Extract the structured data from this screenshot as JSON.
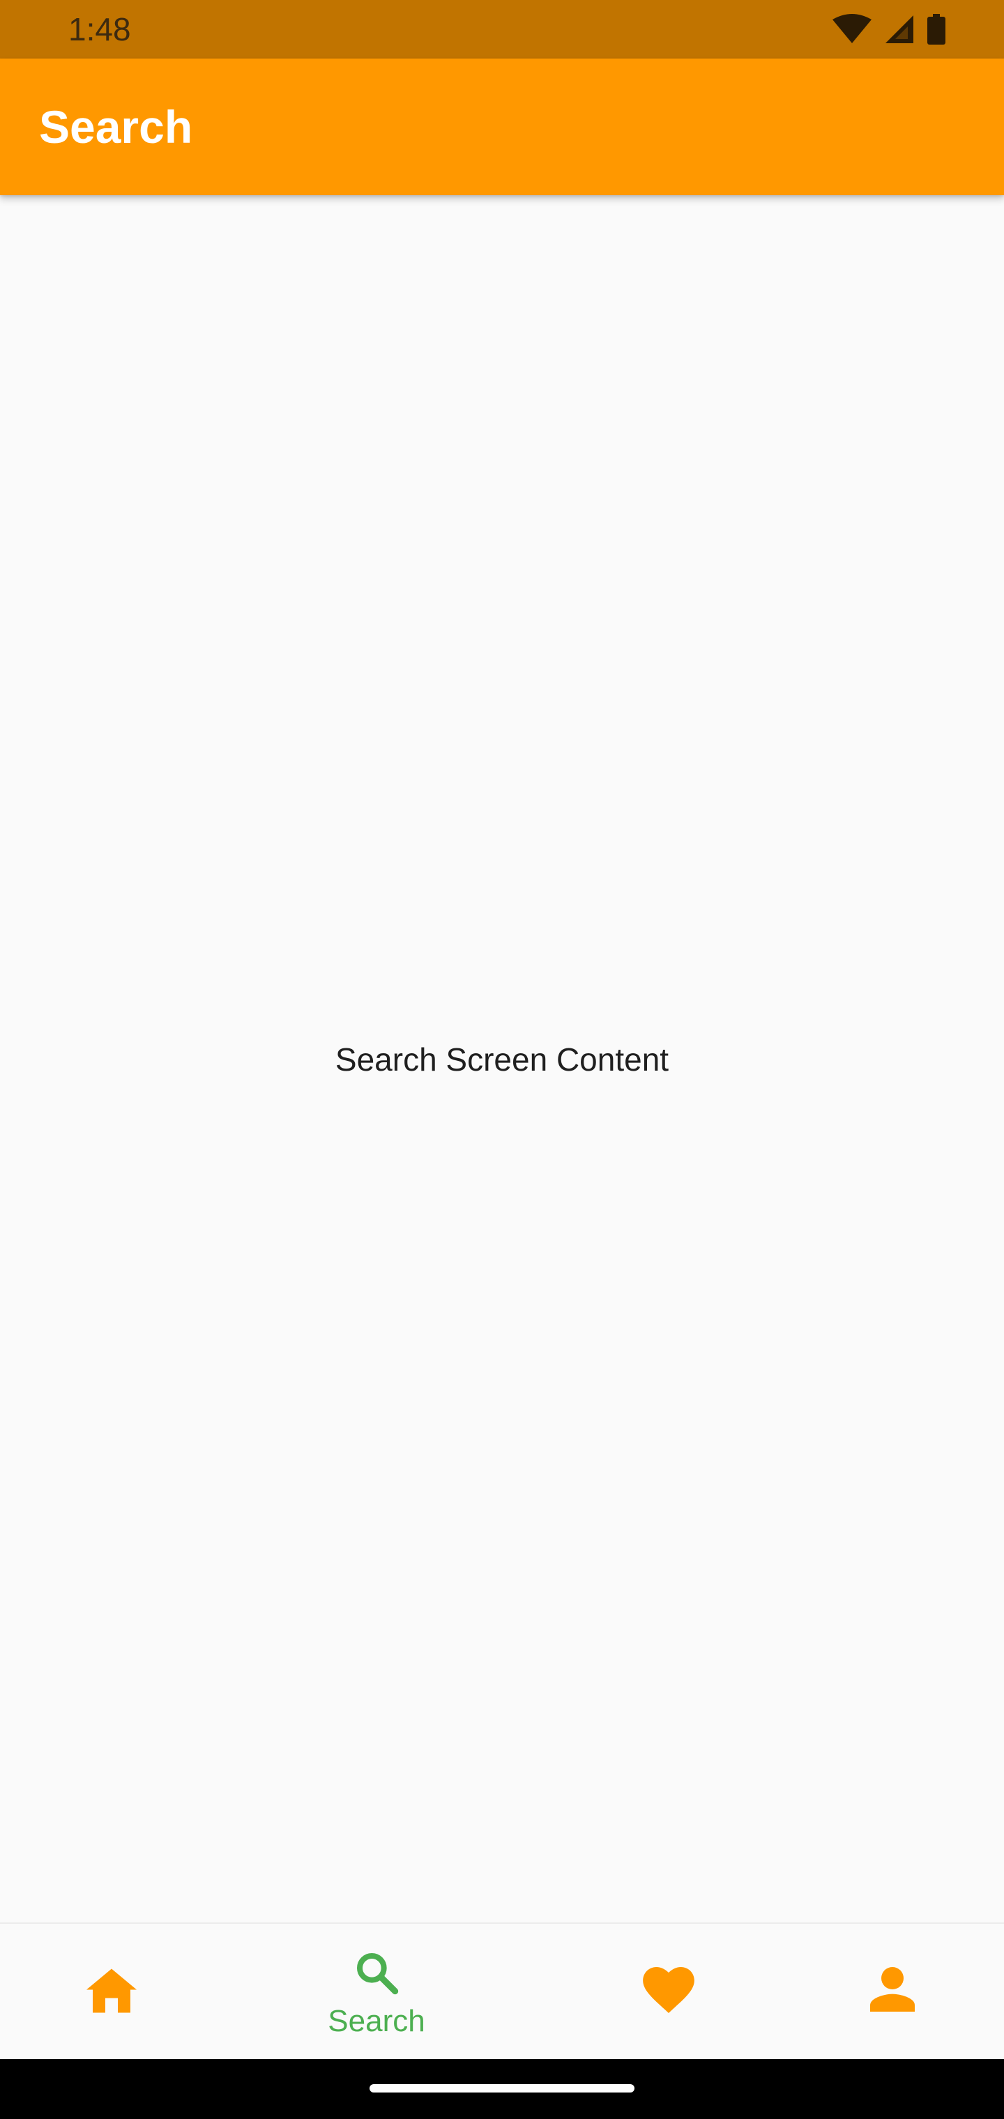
{
  "status_bar": {
    "time": "1:48",
    "icons": [
      "wifi-icon",
      "signal-icon",
      "battery-icon"
    ]
  },
  "app_bar": {
    "title": "Search"
  },
  "body": {
    "content_text": "Search Screen Content"
  },
  "bottom_nav": {
    "items": [
      {
        "icon": "home-icon",
        "label": "",
        "selected": false
      },
      {
        "icon": "search-icon",
        "label": "Search",
        "selected": true
      },
      {
        "icon": "heart-icon",
        "label": "",
        "selected": false
      },
      {
        "icon": "person-icon",
        "label": "",
        "selected": false
      }
    ]
  },
  "colors": {
    "status_bar": "#c17400",
    "app_bar": "#ff9800",
    "nav_inactive": "#ff9800",
    "nav_active": "#4caf50",
    "background": "#fafafa"
  }
}
